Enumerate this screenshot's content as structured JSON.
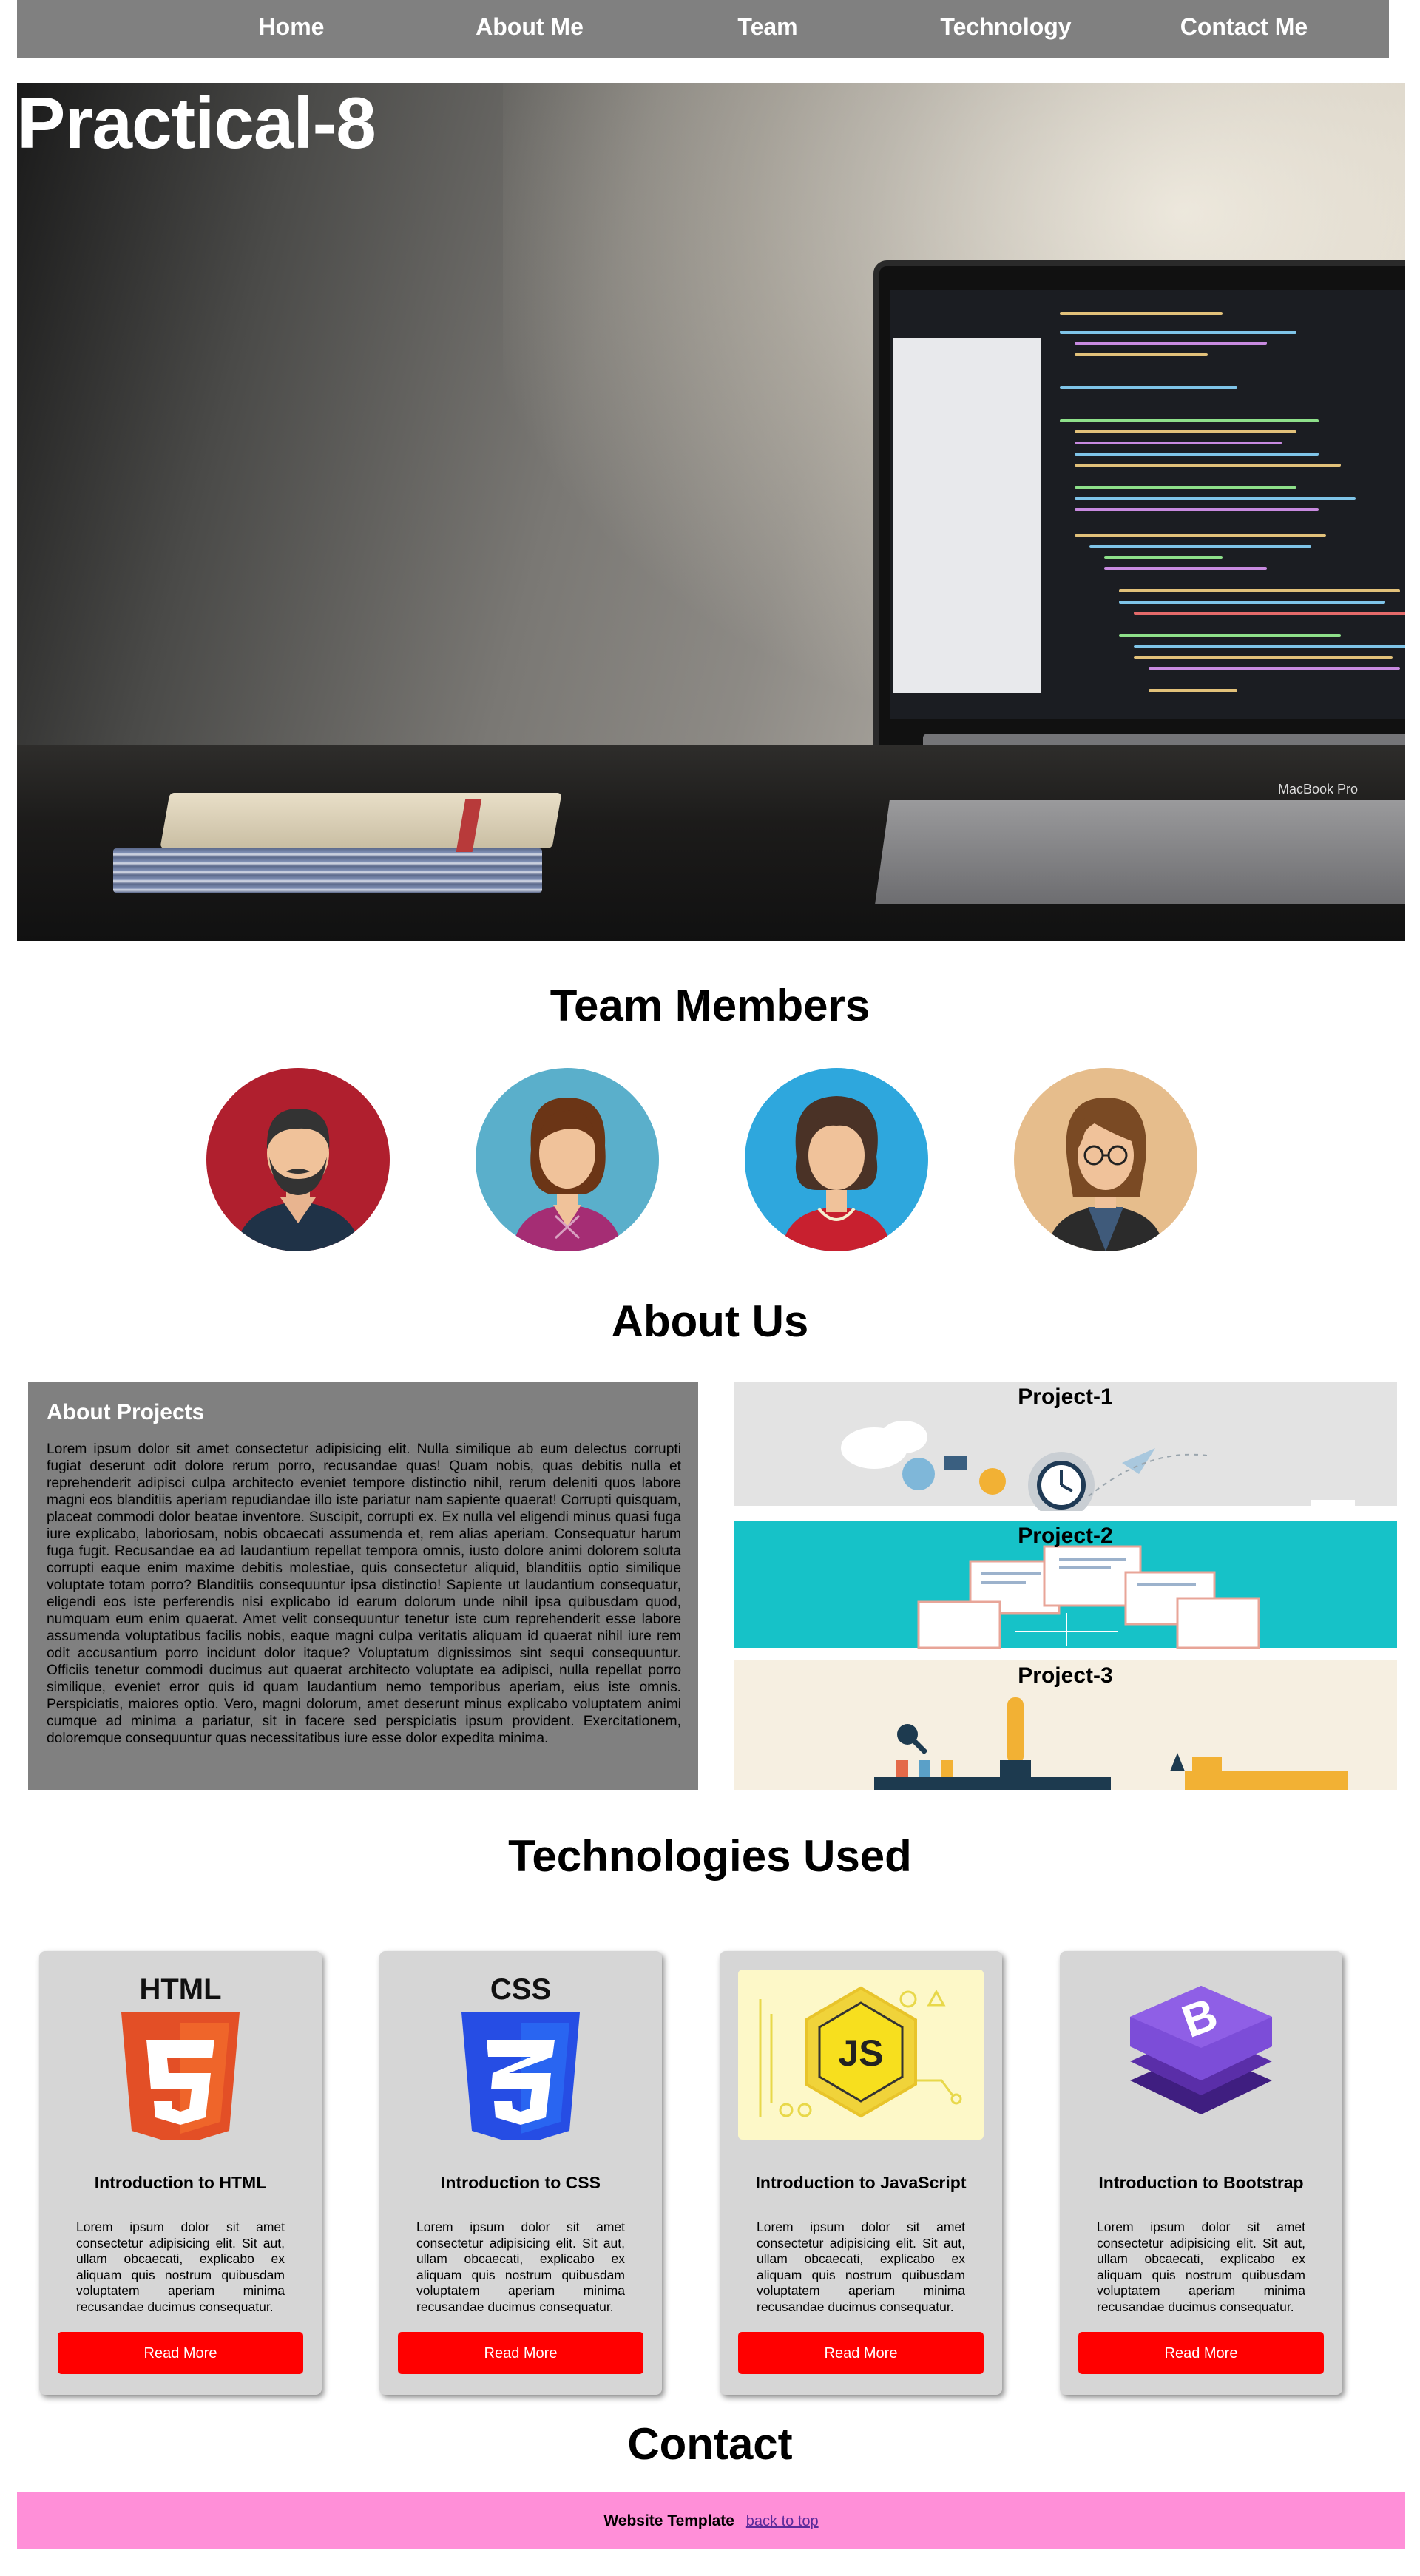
{
  "nav": {
    "items": [
      "Home",
      "About Me",
      "Team",
      "Technology",
      "Contact Me"
    ],
    "background": "#808080"
  },
  "hero": {
    "title": "Practical-8",
    "laptop_label": "MacBook Pro"
  },
  "team": {
    "heading": "Team Members",
    "members": [
      {
        "icon": "man-beard-avatar",
        "bg": "#b01f2e"
      },
      {
        "icon": "woman-brown-hair-avatar",
        "bg": "#5aafcb"
      },
      {
        "icon": "woman-curly-hair-avatar",
        "bg": "#2ea7dd"
      },
      {
        "icon": "woman-glasses-avatar",
        "bg": "#e6bd8c"
      }
    ]
  },
  "about": {
    "heading": "About Us",
    "panel_title": "About Projects",
    "panel_text": "Lorem ipsum dolor sit amet consectetur adipisicing elit. Nulla similique ab eum delectus corrupti fugiat deserunt odit dolore rerum porro, recusandae quas! Quam nobis, quas debitis nulla et reprehenderit adipisci culpa architecto eveniet tempore distinctio nihil, rerum deleniti quos labore magni eos blanditiis aperiam repudiandae illo iste pariatur nam sapiente quaerat! Corrupti quisquam, placeat commodi dolor beatae inventore. Suscipit, corrupti ex. Ex nulla vel eligendi minus quasi fuga iure explicabo, laboriosam, nobis obcaecati assumenda et, rem alias aperiam. Consequatur harum fuga fugit. Recusandae ea ad laudantium repellat tempora omnis, iusto dolore animi dolorem soluta corrupti eaque enim maxime debitis molestiae, quis consectetur aliquid, blanditiis optio similique voluptate totam porro? Blanditiis consequuntur ipsa distinctio! Sapiente ut laudantium consequatur, eligendi eos iste perferendis nisi explicabo id earum dolorum unde nihil ipsa quibusdam quod, numquam eum enim quaerat. Amet velit consequuntur tenetur iste cum reprehenderit esse labore assumenda voluptatibus facilis nobis, eaque magni culpa veritatis aliquam id quaerat nihil iure rem odit accusantium porro incidunt dolor itaque? Voluptatum dignissimos sint sequi consequuntur. Officiis tenetur commodi ducimus aut quaerat architecto voluptate ea adipisci, nulla repellat porro similique, eveniet error quis id quam laudantium nemo temporibus aperiam, eius iste omnis. Perspiciatis, maiores optio. Vero, magni dolorum, amet deserunt minus explicabo voluptatem animi cumque ad minima a pariatur, sit in facere sed perspiciatis ipsum provident. Exercitationem, doloremque consequuntur quas necessitatibus iure esse dolor expedita minima.",
    "projects": [
      "Project-1",
      "Project-2",
      "Project-3"
    ]
  },
  "technologies": {
    "heading": "Technologies Used",
    "cards": [
      {
        "title": "Introduction to HTML",
        "logo": "html5-logo-icon",
        "text": "Lorem ipsum dolor sit amet consectetur adipisicing elit. Sit aut, ullam obcaecati, explicabo ex aliquam quis nostrum quibusdam voluptatem aperiam minima recusandae ducimus consequatur.",
        "button": "Read More"
      },
      {
        "title": "Introduction to CSS",
        "logo": "css3-logo-icon",
        "text": "Lorem ipsum dolor sit amet consectetur adipisicing elit. Sit aut, ullam obcaecati, explicabo ex aliquam quis nostrum quibusdam voluptatem aperiam minima recusandae ducimus consequatur.",
        "button": "Read More"
      },
      {
        "title": "Introduction to JavaScript",
        "logo": "javascript-logo-icon",
        "text": "Lorem ipsum dolor sit amet consectetur adipisicing elit. Sit aut, ullam obcaecati, explicabo ex aliquam quis nostrum quibusdam voluptatem aperiam minima recusandae ducimus consequatur.",
        "button": "Read More"
      },
      {
        "title": "Introduction to Bootstrap",
        "logo": "bootstrap-logo-icon",
        "text": "Lorem ipsum dolor sit amet consectetur adipisicing elit. Sit aut, ullam obcaecati, explicabo ex aliquam quis nostrum quibusdam voluptatem aperiam minima recusandae ducimus consequatur.",
        "button": "Read More"
      }
    ],
    "button_color": "#ff0000"
  },
  "contact": {
    "heading": "Contact"
  },
  "footer": {
    "text": "Website Template",
    "link": "back to top",
    "background": "#ff8fd8"
  }
}
